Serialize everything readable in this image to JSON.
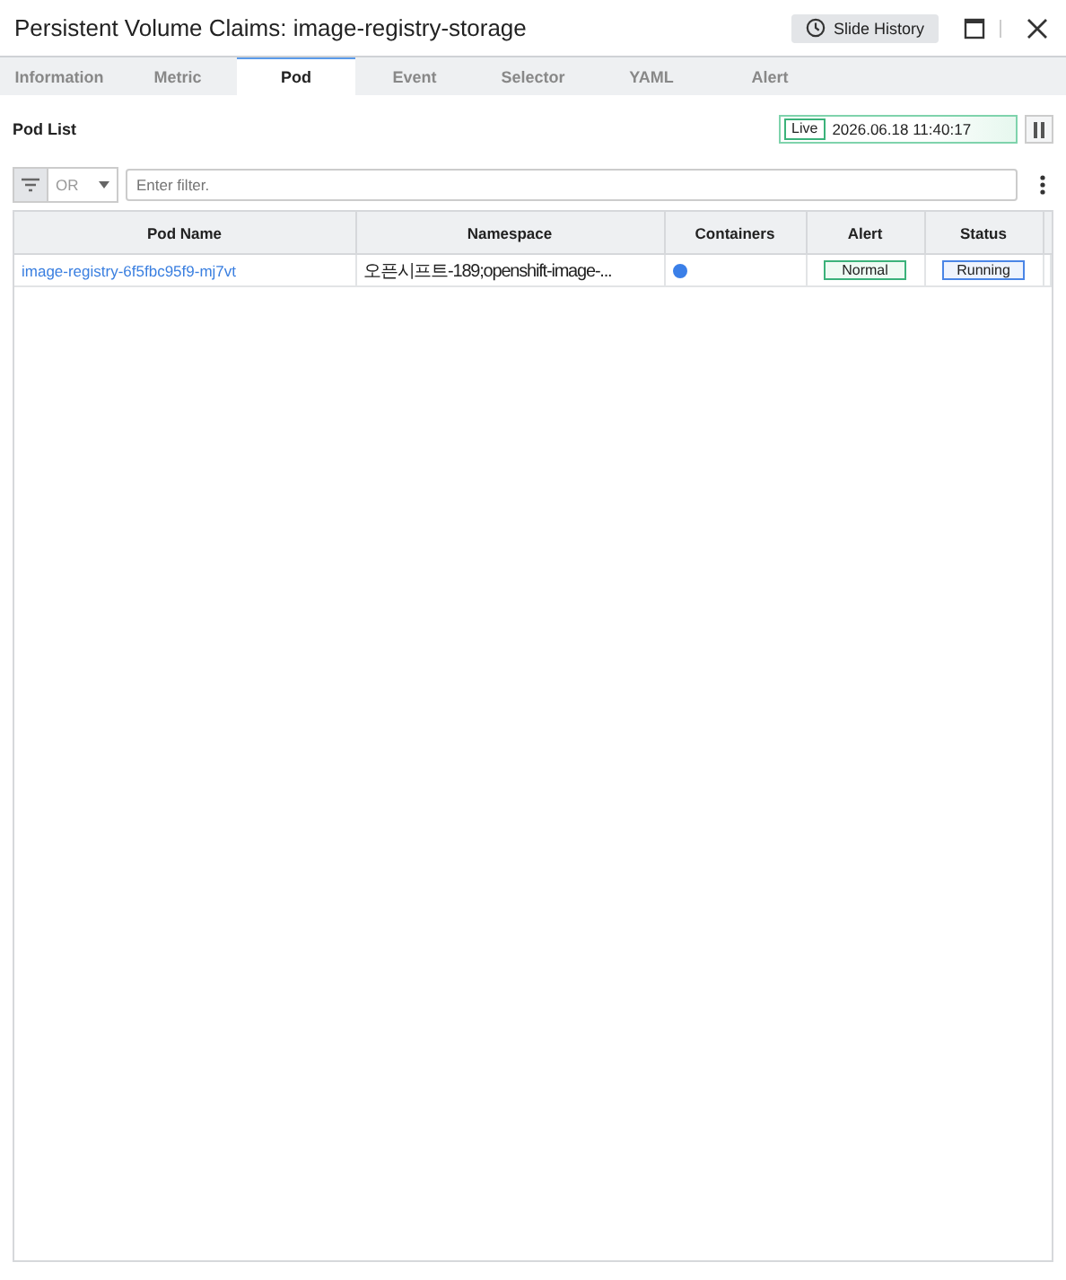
{
  "window": {
    "title": "Persistent Volume Claims: image-registry-storage",
    "history_button": "Slide History"
  },
  "tabs": [
    {
      "label": "Information",
      "selected": false
    },
    {
      "label": "Metric",
      "selected": false
    },
    {
      "label": "Pod",
      "selected": true
    },
    {
      "label": "Event",
      "selected": false
    },
    {
      "label": "Selector",
      "selected": false
    },
    {
      "label": "YAML",
      "selected": false
    },
    {
      "label": "Alert",
      "selected": false
    }
  ],
  "section_title": "Pod List",
  "live": {
    "badge": "Live",
    "time": "2026.06.18 11:40:17"
  },
  "filter": {
    "operator": "OR",
    "placeholder": "Enter filter."
  },
  "table": {
    "columns": [
      "Pod Name",
      "Namespace",
      "Containers",
      "Alert",
      "Status"
    ],
    "rows": [
      {
        "pod_name": "image-registry-6f5fbc95f9-mj7vt",
        "namespace": "오픈시프트-189;openshift-image-...",
        "alert": "Normal",
        "status": "Running"
      }
    ]
  }
}
